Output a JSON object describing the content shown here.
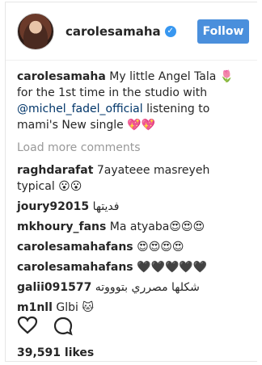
{
  "header": {
    "username": "carolesamaha",
    "verified_icon": "verified-check",
    "follow_label": "Follow"
  },
  "caption": {
    "username": "carolesamaha",
    "text_part1": "My little Angel Tala ",
    "flower": "🌷",
    "text_part2": " for the 1st time in the studio with ",
    "mention": "@michel_fadel_official",
    "text_part3": " listening to mami's New single ",
    "hearts": "💖💖"
  },
  "load_more": "Load more comments",
  "comments": [
    {
      "user": "raghdarafat",
      "text": "7ayateee masreyeh typical 😮😮"
    },
    {
      "user": "joury92015",
      "text": "فديتها"
    },
    {
      "user": "mkhoury_fans",
      "text": "Ma atyaba😍😍😍"
    },
    {
      "user": "carolesamahafans",
      "text": "😍😍😍😍"
    },
    {
      "user": "carolesamahafans",
      "text": "🖤🖤🖤🖤🖤"
    },
    {
      "user": "galii091577",
      "text": "شكلها مصرري بتوووته"
    },
    {
      "user": "m1nll",
      "text": "Glbi 🐱"
    }
  ],
  "likes": "39,591 likes",
  "colors": {
    "follow_button": "#4a8fdc",
    "verified": "#3897f0",
    "link": "#003569",
    "muted": "#999999"
  }
}
